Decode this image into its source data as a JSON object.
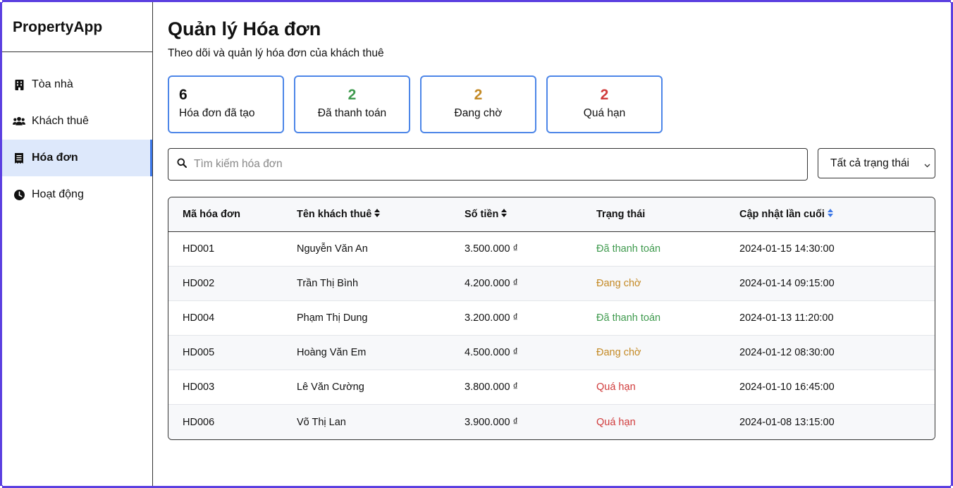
{
  "app": {
    "brand": "PropertyApp"
  },
  "sidebar": {
    "items": [
      {
        "label": "Tòa nhà",
        "icon": "building-icon",
        "active": false
      },
      {
        "label": "Khách thuê",
        "icon": "users-icon",
        "active": false
      },
      {
        "label": "Hóa đơn",
        "icon": "receipt-icon",
        "active": true
      },
      {
        "label": "Hoạt động",
        "icon": "clock-icon",
        "active": false
      }
    ]
  },
  "header": {
    "title": "Quản lý Hóa đơn",
    "subtitle": "Theo dõi và quản lý hóa đơn của khách thuê"
  },
  "stats": [
    {
      "value": "6",
      "label": "Hóa đơn đã tạo",
      "color": "#111111"
    },
    {
      "value": "2",
      "label": "Đã thanh toán",
      "color": "#3f9a4e"
    },
    {
      "value": "2",
      "label": "Đang chờ",
      "color": "#c48a26"
    },
    {
      "value": "2",
      "label": "Quá hạn",
      "color": "#d03b3b"
    }
  ],
  "search": {
    "placeholder": "Tìm kiếm hóa đơn",
    "value": ""
  },
  "filter": {
    "selected": "Tất cả trạng thái"
  },
  "table": {
    "headers": [
      "Mã hóa đơn",
      "Tên khách thuê",
      "Số tiền",
      "Trạng thái",
      "Cập nhật lần cuối"
    ],
    "rows": [
      {
        "id": "HD001",
        "tenant": "Nguyễn Văn An",
        "amount": "3.500.000 ₫",
        "status": "Đã thanh toán",
        "updated": "2024-01-15 14:30:00"
      },
      {
        "id": "HD002",
        "tenant": "Trần Thị Bình",
        "amount": "4.200.000 ₫",
        "status": "Đang chờ",
        "updated": "2024-01-14 09:15:00"
      },
      {
        "id": "HD004",
        "tenant": "Phạm Thị Dung",
        "amount": "3.200.000 ₫",
        "status": "Đã thanh toán",
        "updated": "2024-01-13 11:20:00"
      },
      {
        "id": "HD005",
        "tenant": "Hoàng Văn Em",
        "amount": "4.500.000 ₫",
        "status": "Đang chờ",
        "updated": "2024-01-12 08:30:00"
      },
      {
        "id": "HD003",
        "tenant": "Lê Văn Cường",
        "amount": "3.800.000 ₫",
        "status": "Quá hạn",
        "updated": "2024-01-10 16:45:00"
      },
      {
        "id": "HD006",
        "tenant": "Võ Thị Lan",
        "amount": "3.900.000 ₫",
        "status": "Quá hạn",
        "updated": "2024-01-08 13:15:00"
      }
    ]
  },
  "colors": {
    "accent": "#3b76e6",
    "paid": "#3f9a4e",
    "pending": "#c48a26",
    "overdue": "#d03b3b",
    "frame": "#5b3fe0"
  }
}
